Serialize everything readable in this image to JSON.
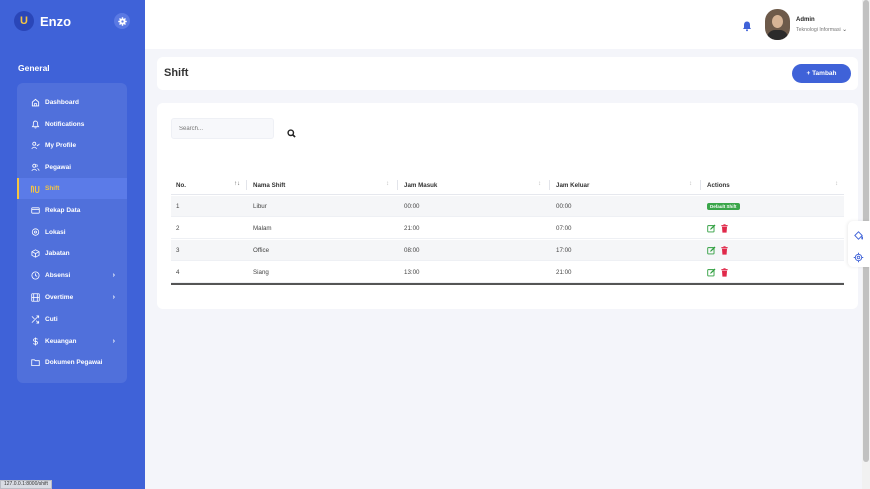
{
  "brand": {
    "logo_text": "U",
    "name": "Enzo"
  },
  "sidebar": {
    "section": "General",
    "items": [
      {
        "label": "Dashboard",
        "icon": "home-icon",
        "active": false,
        "has_submenu": false
      },
      {
        "label": "Notifications",
        "icon": "bell-icon",
        "active": false,
        "has_submenu": false
      },
      {
        "label": "My Profile",
        "icon": "user-check-icon",
        "active": false,
        "has_submenu": false
      },
      {
        "label": "Pegawai",
        "icon": "users-icon",
        "active": false,
        "has_submenu": false
      },
      {
        "label": "Shift",
        "icon": "shift-icon",
        "active": true,
        "has_submenu": false
      },
      {
        "label": "Rekap Data",
        "icon": "credit-card-icon",
        "active": false,
        "has_submenu": false
      },
      {
        "label": "Lokasi",
        "icon": "map-pin-icon",
        "active": false,
        "has_submenu": false
      },
      {
        "label": "Jabatan",
        "icon": "box-icon",
        "active": false,
        "has_submenu": false
      },
      {
        "label": "Absensi",
        "icon": "clock-icon",
        "active": false,
        "has_submenu": true
      },
      {
        "label": "Overtime",
        "icon": "film-icon",
        "active": false,
        "has_submenu": true
      },
      {
        "label": "Cuti",
        "icon": "shuffle-icon",
        "active": false,
        "has_submenu": false
      },
      {
        "label": "Keuangan",
        "icon": "dollar-icon",
        "active": false,
        "has_submenu": true
      },
      {
        "label": "Dokumen Pegawai",
        "icon": "folder-icon",
        "active": false,
        "has_submenu": false
      }
    ]
  },
  "status_url": "127.0.0.1:8000/shift",
  "user": {
    "name": "Admin",
    "role": "Teknologi Informasi"
  },
  "page": {
    "title": "Shift",
    "add_button": "+ Tambah"
  },
  "search": {
    "placeholder": "Search..."
  },
  "table": {
    "columns": [
      "No.",
      "Nama Shift",
      "Jam Masuk",
      "Jam Keluar",
      "Actions"
    ],
    "rows": [
      {
        "no": "1",
        "nama": "Libur",
        "masuk": "00:00",
        "keluar": "00:00",
        "badge": "Default Shift"
      },
      {
        "no": "2",
        "nama": "Malam",
        "masuk": "21:00",
        "keluar": "07:00",
        "badge": null
      },
      {
        "no": "3",
        "nama": "Office",
        "masuk": "08:00",
        "keluar": "17:00",
        "badge": null
      },
      {
        "no": "4",
        "nama": "Siang",
        "masuk": "13:00",
        "keluar": "21:00",
        "badge": null
      }
    ]
  },
  "colors": {
    "primary": "#3f62d8",
    "accent": "#f5c542",
    "success": "#3aa64a",
    "danger": "#e0294a"
  }
}
